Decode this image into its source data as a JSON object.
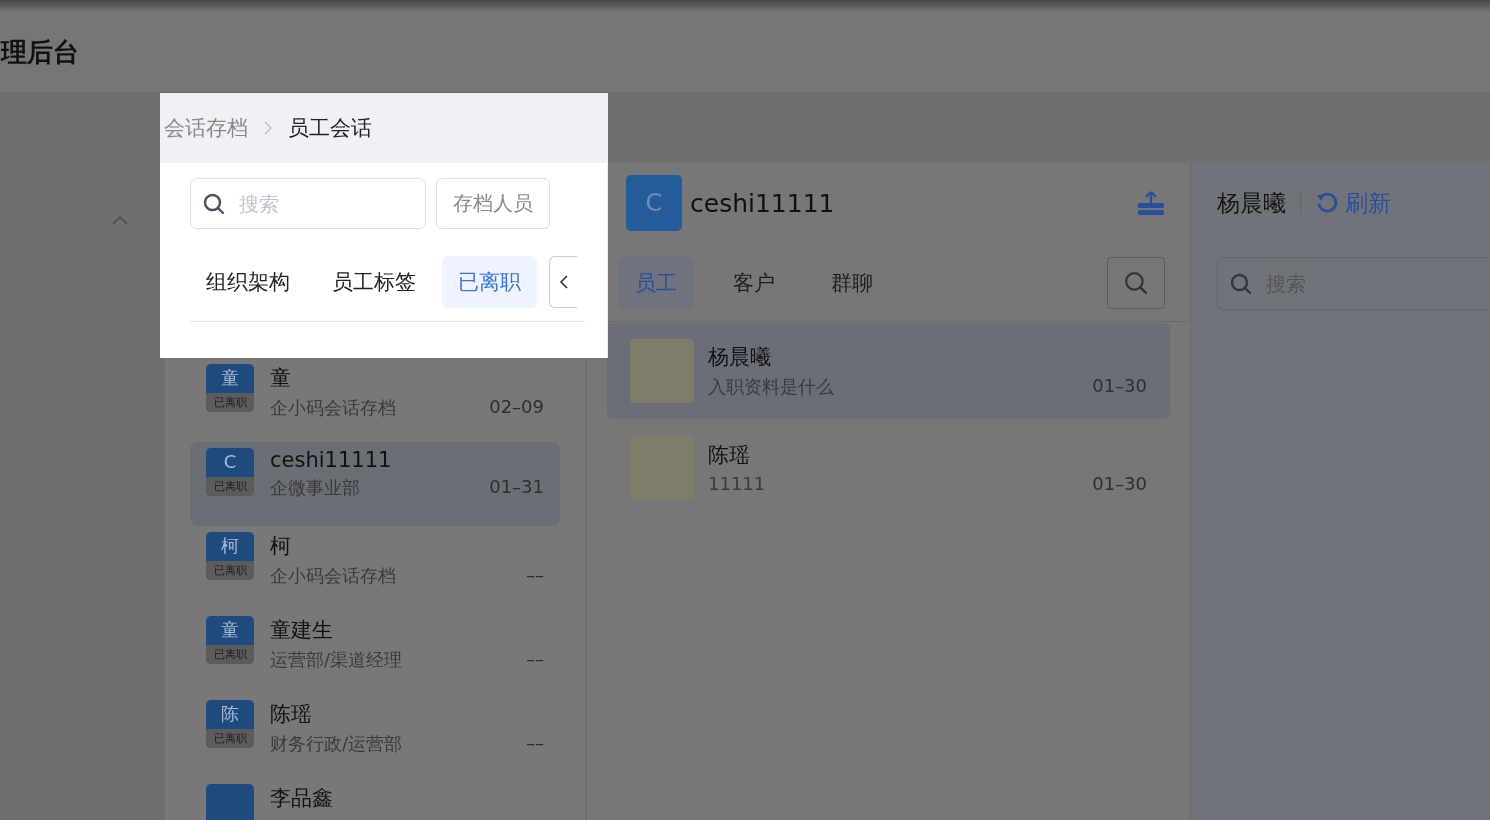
{
  "header": {
    "title": "理后台"
  },
  "breadcrumb": [
    {
      "label": "会话存档",
      "current": false
    },
    {
      "label": "员工会话",
      "current": true
    }
  ],
  "left_panel": {
    "search": {
      "placeholder": "搜索"
    },
    "archive_button": "存档人员",
    "tabs": [
      {
        "label": "组织架构",
        "selected": false
      },
      {
        "label": "员工标签",
        "selected": false
      },
      {
        "label": "已离职",
        "selected": true
      }
    ],
    "contacts": [
      {
        "avatar_char": "童",
        "badge": "已离职",
        "name": "童",
        "subtitle": "企小码会话存档",
        "date": "02–09",
        "selected": false
      },
      {
        "avatar_char": "C",
        "badge": "已离职",
        "name": "ceshi11111",
        "subtitle": "企微事业部",
        "date": "01–31",
        "selected": true
      },
      {
        "avatar_char": "柯",
        "badge": "已离职",
        "name": "柯",
        "subtitle": "企小码会话存档",
        "date": "––",
        "selected": false
      },
      {
        "avatar_char": "童",
        "badge": "已离职",
        "name": "童建生",
        "subtitle": "运营部/渠道经理",
        "date": "––",
        "selected": false
      },
      {
        "avatar_char": "陈",
        "badge": "已离职",
        "name": "陈瑶",
        "subtitle": "财务行政/运营部",
        "date": "––",
        "selected": false
      },
      {
        "name": "李品鑫",
        "selected": false
      }
    ]
  },
  "chat_panel": {
    "avatar_char": "C",
    "name": "ceshi11111",
    "tabs": [
      {
        "label": "员工",
        "selected": true
      },
      {
        "label": "客户",
        "selected": false
      },
      {
        "label": "群聊",
        "selected": false
      }
    ],
    "conversations": [
      {
        "name": "杨晨曦",
        "preview": "入职资料是什么",
        "date": "01–30",
        "selected": true
      },
      {
        "name": "陈瑶",
        "preview": "11111",
        "date": "01–30",
        "selected": false
      }
    ]
  },
  "detail_panel": {
    "name": "杨晨曦",
    "refresh": "刷新",
    "search": {
      "placeholder": "搜索"
    }
  }
}
